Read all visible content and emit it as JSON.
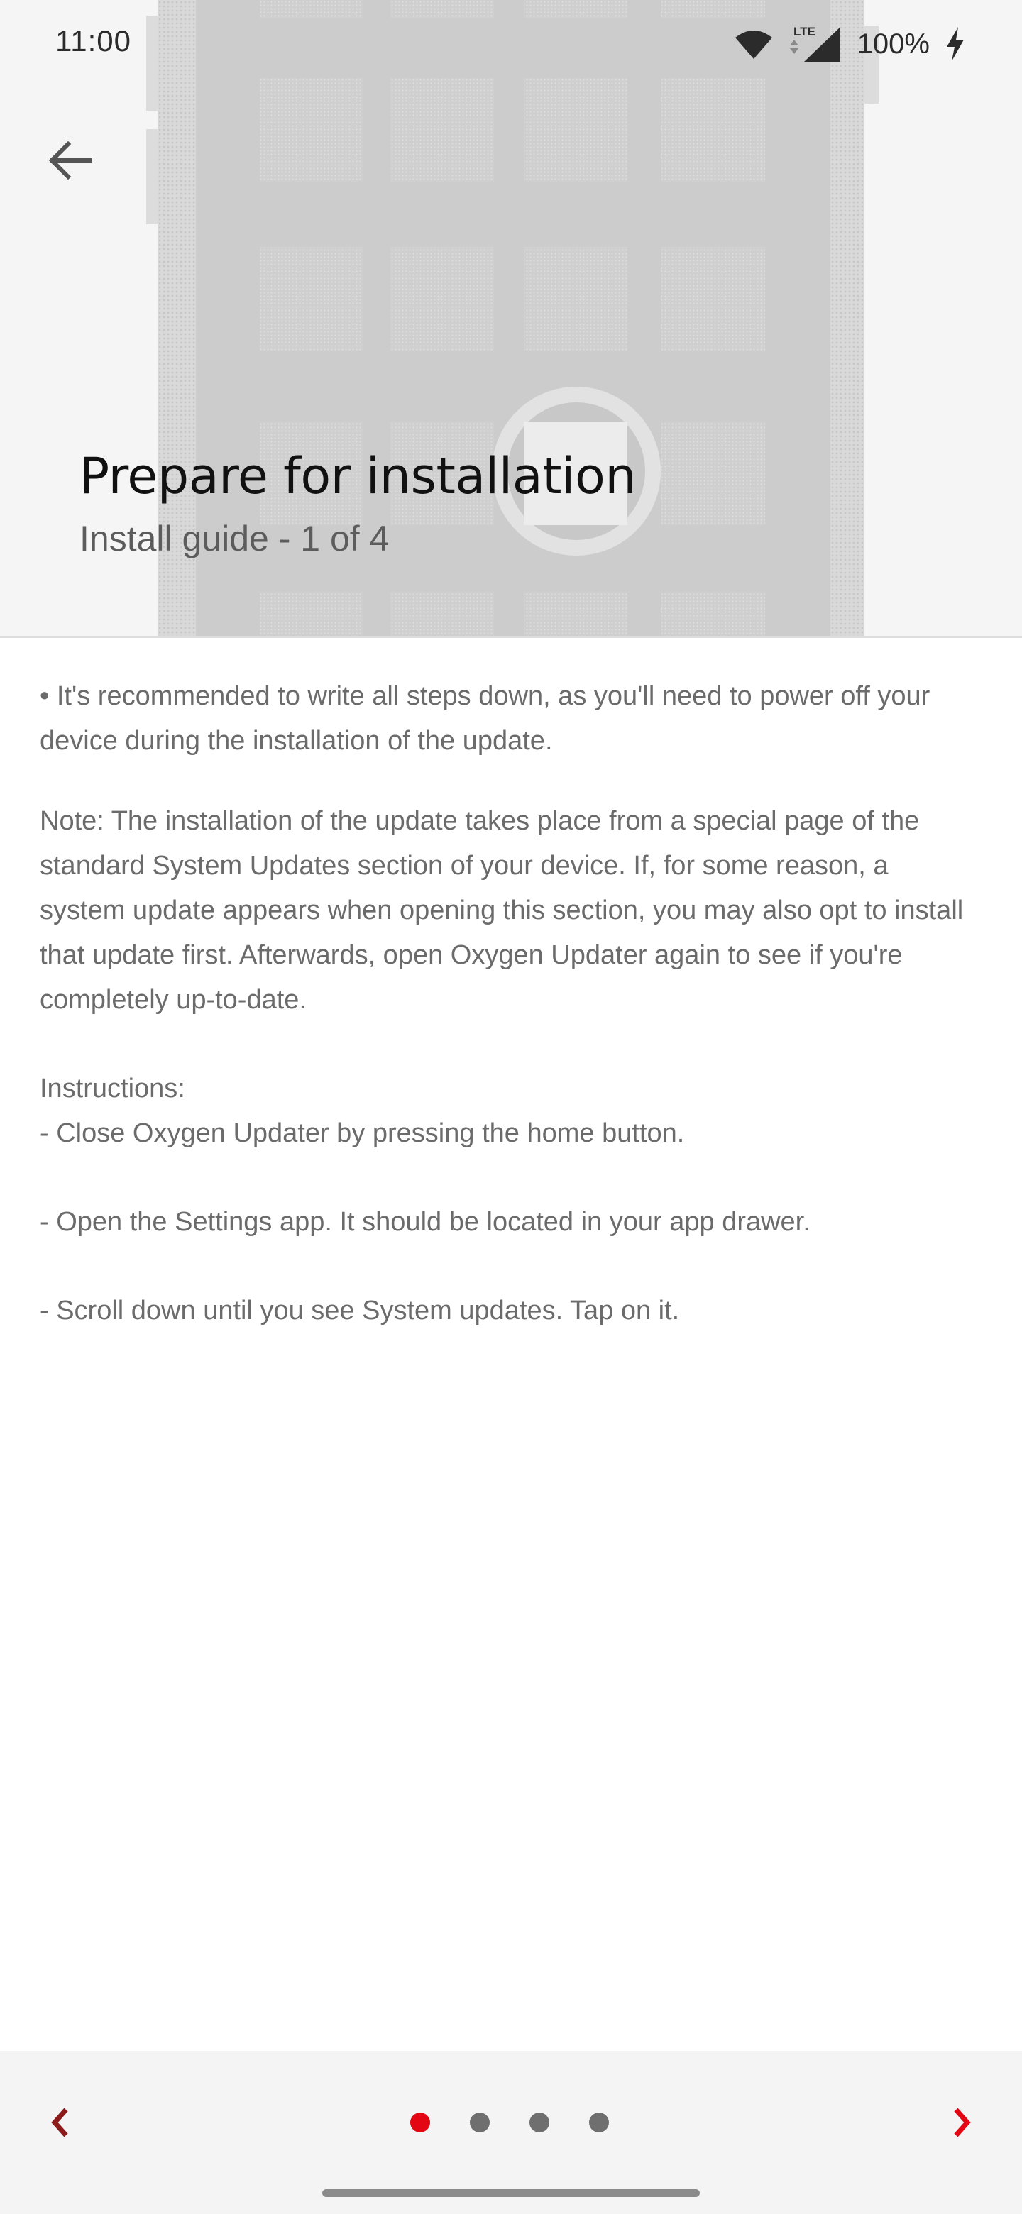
{
  "status_bar": {
    "time": "11:00",
    "network": "LTE",
    "battery": "100%",
    "icons": [
      "wifi-icon",
      "signal-icon",
      "charging-icon"
    ]
  },
  "header": {
    "title": "Prepare for installation",
    "subtitle": "Install guide - 1 of 4",
    "back_icon": "arrow-left-icon"
  },
  "content": {
    "bullet": "• It's recommended to write all steps down, as you'll need to power off your device during the installation of the update.",
    "note": "Note: The installation of the update takes place from a special page of the standard System Updates section of your device. If, for some reason, a system update appears when opening this section, you may also opt to install that update first. Afterwards, open Oxygen Updater again to see if you're completely up-to-date.",
    "instructions_label": "Instructions:",
    "steps": [
      "- Close Oxygen Updater by pressing the home button.",
      "- Open the Settings app. It should be located in your app drawer.",
      "- Scroll down until you see System updates. Tap on it."
    ]
  },
  "pager": {
    "current": 1,
    "total": 4,
    "prev_icon": "chevron-left-icon",
    "next_icon": "chevron-right-icon"
  },
  "colors": {
    "accent": "#e30613",
    "dot_inactive": "#6f6f6f",
    "header_bg": "#f5f5f5",
    "body_text": "#6b6b6b"
  }
}
